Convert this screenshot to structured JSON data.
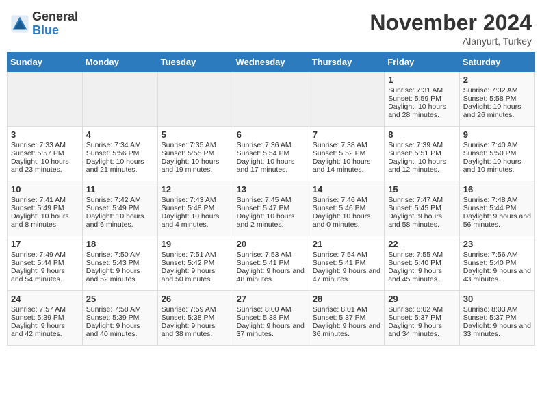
{
  "header": {
    "logo_general": "General",
    "logo_blue": "Blue",
    "month_title": "November 2024",
    "location": "Alanyurt, Turkey"
  },
  "days_of_week": [
    "Sunday",
    "Monday",
    "Tuesday",
    "Wednesday",
    "Thursday",
    "Friday",
    "Saturday"
  ],
  "weeks": [
    [
      {
        "day": "",
        "info": ""
      },
      {
        "day": "",
        "info": ""
      },
      {
        "day": "",
        "info": ""
      },
      {
        "day": "",
        "info": ""
      },
      {
        "day": "",
        "info": ""
      },
      {
        "day": "1",
        "info": "Sunrise: 7:31 AM\nSunset: 5:59 PM\nDaylight: 10 hours and 28 minutes."
      },
      {
        "day": "2",
        "info": "Sunrise: 7:32 AM\nSunset: 5:58 PM\nDaylight: 10 hours and 26 minutes."
      }
    ],
    [
      {
        "day": "3",
        "info": "Sunrise: 7:33 AM\nSunset: 5:57 PM\nDaylight: 10 hours and 23 minutes."
      },
      {
        "day": "4",
        "info": "Sunrise: 7:34 AM\nSunset: 5:56 PM\nDaylight: 10 hours and 21 minutes."
      },
      {
        "day": "5",
        "info": "Sunrise: 7:35 AM\nSunset: 5:55 PM\nDaylight: 10 hours and 19 minutes."
      },
      {
        "day": "6",
        "info": "Sunrise: 7:36 AM\nSunset: 5:54 PM\nDaylight: 10 hours and 17 minutes."
      },
      {
        "day": "7",
        "info": "Sunrise: 7:38 AM\nSunset: 5:52 PM\nDaylight: 10 hours and 14 minutes."
      },
      {
        "day": "8",
        "info": "Sunrise: 7:39 AM\nSunset: 5:51 PM\nDaylight: 10 hours and 12 minutes."
      },
      {
        "day": "9",
        "info": "Sunrise: 7:40 AM\nSunset: 5:50 PM\nDaylight: 10 hours and 10 minutes."
      }
    ],
    [
      {
        "day": "10",
        "info": "Sunrise: 7:41 AM\nSunset: 5:49 PM\nDaylight: 10 hours and 8 minutes."
      },
      {
        "day": "11",
        "info": "Sunrise: 7:42 AM\nSunset: 5:49 PM\nDaylight: 10 hours and 6 minutes."
      },
      {
        "day": "12",
        "info": "Sunrise: 7:43 AM\nSunset: 5:48 PM\nDaylight: 10 hours and 4 minutes."
      },
      {
        "day": "13",
        "info": "Sunrise: 7:45 AM\nSunset: 5:47 PM\nDaylight: 10 hours and 2 minutes."
      },
      {
        "day": "14",
        "info": "Sunrise: 7:46 AM\nSunset: 5:46 PM\nDaylight: 10 hours and 0 minutes."
      },
      {
        "day": "15",
        "info": "Sunrise: 7:47 AM\nSunset: 5:45 PM\nDaylight: 9 hours and 58 minutes."
      },
      {
        "day": "16",
        "info": "Sunrise: 7:48 AM\nSunset: 5:44 PM\nDaylight: 9 hours and 56 minutes."
      }
    ],
    [
      {
        "day": "17",
        "info": "Sunrise: 7:49 AM\nSunset: 5:44 PM\nDaylight: 9 hours and 54 minutes."
      },
      {
        "day": "18",
        "info": "Sunrise: 7:50 AM\nSunset: 5:43 PM\nDaylight: 9 hours and 52 minutes."
      },
      {
        "day": "19",
        "info": "Sunrise: 7:51 AM\nSunset: 5:42 PM\nDaylight: 9 hours and 50 minutes."
      },
      {
        "day": "20",
        "info": "Sunrise: 7:53 AM\nSunset: 5:41 PM\nDaylight: 9 hours and 48 minutes."
      },
      {
        "day": "21",
        "info": "Sunrise: 7:54 AM\nSunset: 5:41 PM\nDaylight: 9 hours and 47 minutes."
      },
      {
        "day": "22",
        "info": "Sunrise: 7:55 AM\nSunset: 5:40 PM\nDaylight: 9 hours and 45 minutes."
      },
      {
        "day": "23",
        "info": "Sunrise: 7:56 AM\nSunset: 5:40 PM\nDaylight: 9 hours and 43 minutes."
      }
    ],
    [
      {
        "day": "24",
        "info": "Sunrise: 7:57 AM\nSunset: 5:39 PM\nDaylight: 9 hours and 42 minutes."
      },
      {
        "day": "25",
        "info": "Sunrise: 7:58 AM\nSunset: 5:39 PM\nDaylight: 9 hours and 40 minutes."
      },
      {
        "day": "26",
        "info": "Sunrise: 7:59 AM\nSunset: 5:38 PM\nDaylight: 9 hours and 38 minutes."
      },
      {
        "day": "27",
        "info": "Sunrise: 8:00 AM\nSunset: 5:38 PM\nDaylight: 9 hours and 37 minutes."
      },
      {
        "day": "28",
        "info": "Sunrise: 8:01 AM\nSunset: 5:37 PM\nDaylight: 9 hours and 36 minutes."
      },
      {
        "day": "29",
        "info": "Sunrise: 8:02 AM\nSunset: 5:37 PM\nDaylight: 9 hours and 34 minutes."
      },
      {
        "day": "30",
        "info": "Sunrise: 8:03 AM\nSunset: 5:37 PM\nDaylight: 9 hours and 33 minutes."
      }
    ]
  ]
}
